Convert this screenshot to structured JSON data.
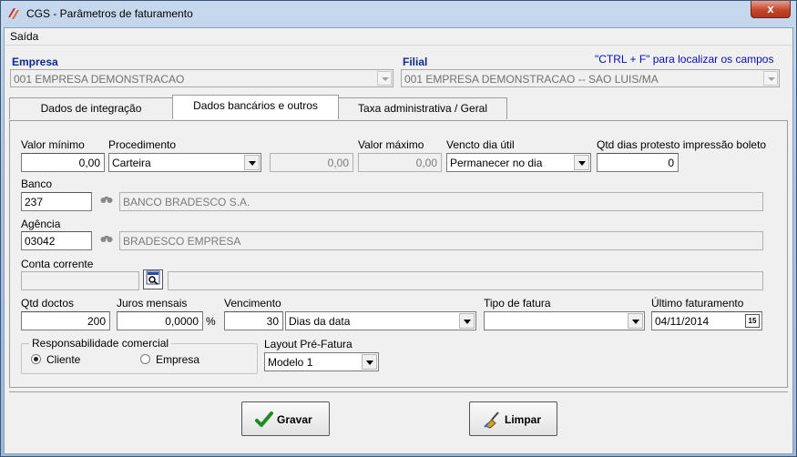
{
  "window": {
    "title": "CGS - Parâmetros de faturamento",
    "close_glyph": "x"
  },
  "menu": {
    "items": [
      {
        "label": "Saída"
      }
    ]
  },
  "hint": "\"CTRL + F\" para localizar os campos",
  "empresa": {
    "label": "Empresa",
    "value": "001 EMPRESA DEMONSTRACAO"
  },
  "filial": {
    "label": "Filial",
    "value": "001 EMPRESA DEMONSTRACAO -- SAO LUIS/MA"
  },
  "tabs": [
    {
      "label": "Dados de integração"
    },
    {
      "label": "Dados bancários e outros",
      "active": true
    },
    {
      "label": "Taxa administrativa / Geral"
    }
  ],
  "form": {
    "valor_minimo": {
      "label": "Valor mínimo",
      "value": "0,00"
    },
    "procedimento": {
      "label": "Procedimento",
      "value": "Carteira"
    },
    "procedimento_valor": {
      "value": "0,00"
    },
    "valor_maximo": {
      "label": "Valor máximo",
      "value": "0,00"
    },
    "vencto_dia_util": {
      "label": "Vencto dia útil",
      "value": "Permanecer no dia"
    },
    "qtd_dias_protesto": {
      "label": "Qtd dias protesto impressão boleto",
      "value": "0"
    },
    "banco": {
      "label": "Banco",
      "code": "237",
      "name": "BANCO BRADESCO S.A."
    },
    "agencia": {
      "label": "Agência",
      "code": "03042",
      "name": "BRADESCO EMPRESA"
    },
    "conta_corrente": {
      "label": "Conta corrente",
      "code": "",
      "name": ""
    },
    "qtd_doctos": {
      "label": "Qtd doctos",
      "value": "200"
    },
    "juros_mensais": {
      "label": "Juros mensais",
      "value": "0,0000",
      "unit": "%"
    },
    "vencimento": {
      "label": "Vencimento",
      "days": "30",
      "type": "Dias da data"
    },
    "tipo_fatura": {
      "label": "Tipo de fatura",
      "value": ""
    },
    "ultimo_faturamento": {
      "label": "Último faturamento",
      "value": "04/11/2014",
      "cal_glyph": "15"
    },
    "responsabilidade": {
      "label": "Responsabilidade comercial",
      "options": [
        {
          "label": "Cliente",
          "selected": true
        },
        {
          "label": "Empresa",
          "selected": false
        }
      ]
    },
    "layout_pre_fatura": {
      "label": "Layout Pré-Fatura",
      "value": "Modelo 1"
    }
  },
  "buttons": {
    "gravar": "Gravar",
    "limpar": "Limpar"
  },
  "colors": {
    "accent_blue": "#102a8f",
    "hint_blue": "#0a0ab8",
    "close_red": "#c4472c",
    "check_green": "#1f8a1f"
  }
}
